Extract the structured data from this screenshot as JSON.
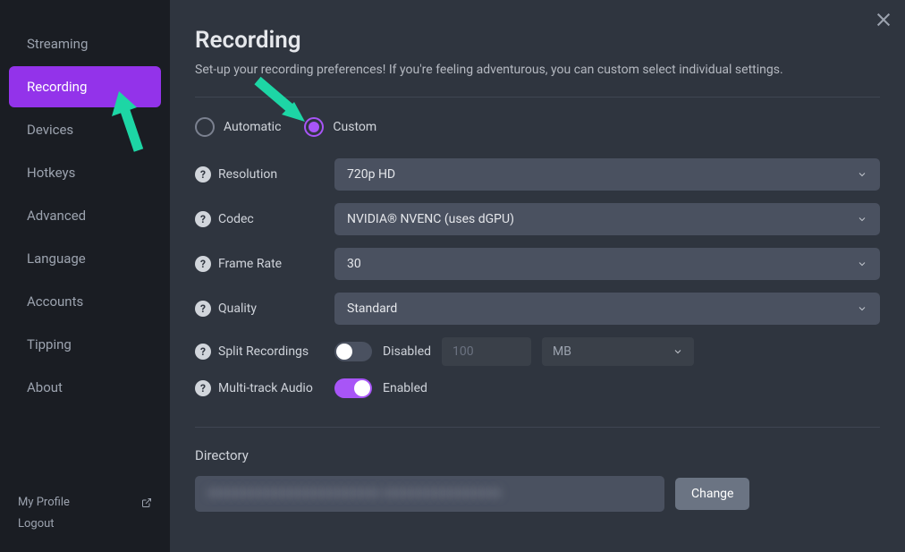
{
  "sidebar": {
    "items": [
      {
        "label": "Streaming",
        "active": false
      },
      {
        "label": "Recording",
        "active": true
      },
      {
        "label": "Devices",
        "active": false
      },
      {
        "label": "Hotkeys",
        "active": false
      },
      {
        "label": "Advanced",
        "active": false
      },
      {
        "label": "Language",
        "active": false
      },
      {
        "label": "Accounts",
        "active": false
      },
      {
        "label": "Tipping",
        "active": false
      },
      {
        "label": "About",
        "active": false
      }
    ],
    "footer": {
      "profile": "My Profile",
      "logout": "Logout"
    }
  },
  "page": {
    "title": "Recording",
    "subtitle": "Set-up your recording preferences! If you're feeling adventurous, you can custom select individual settings."
  },
  "mode": {
    "automatic_label": "Automatic",
    "custom_label": "Custom",
    "selected": "custom"
  },
  "settings": {
    "resolution": {
      "label": "Resolution",
      "value": "720p HD"
    },
    "codec": {
      "label": "Codec",
      "value": "NVIDIA® NVENC (uses dGPU)"
    },
    "framerate": {
      "label": "Frame Rate",
      "value": "30"
    },
    "quality": {
      "label": "Quality",
      "value": "Standard"
    },
    "split": {
      "label": "Split Recordings",
      "state_label": "Disabled",
      "size_placeholder": "100",
      "unit_value": "MB"
    },
    "multitrack": {
      "label": "Multi-track Audio",
      "state_label": "Enabled"
    }
  },
  "directory": {
    "label": "Directory",
    "path": "XXXXXXXXXXXXXXXXXXXXXX   XXXXXXXXXXXXXXX",
    "change_button": "Change"
  },
  "colors": {
    "accent": "#a855f7",
    "sidebar_active": "#9333ea",
    "annotation_arrow": "#1dd6a5"
  }
}
